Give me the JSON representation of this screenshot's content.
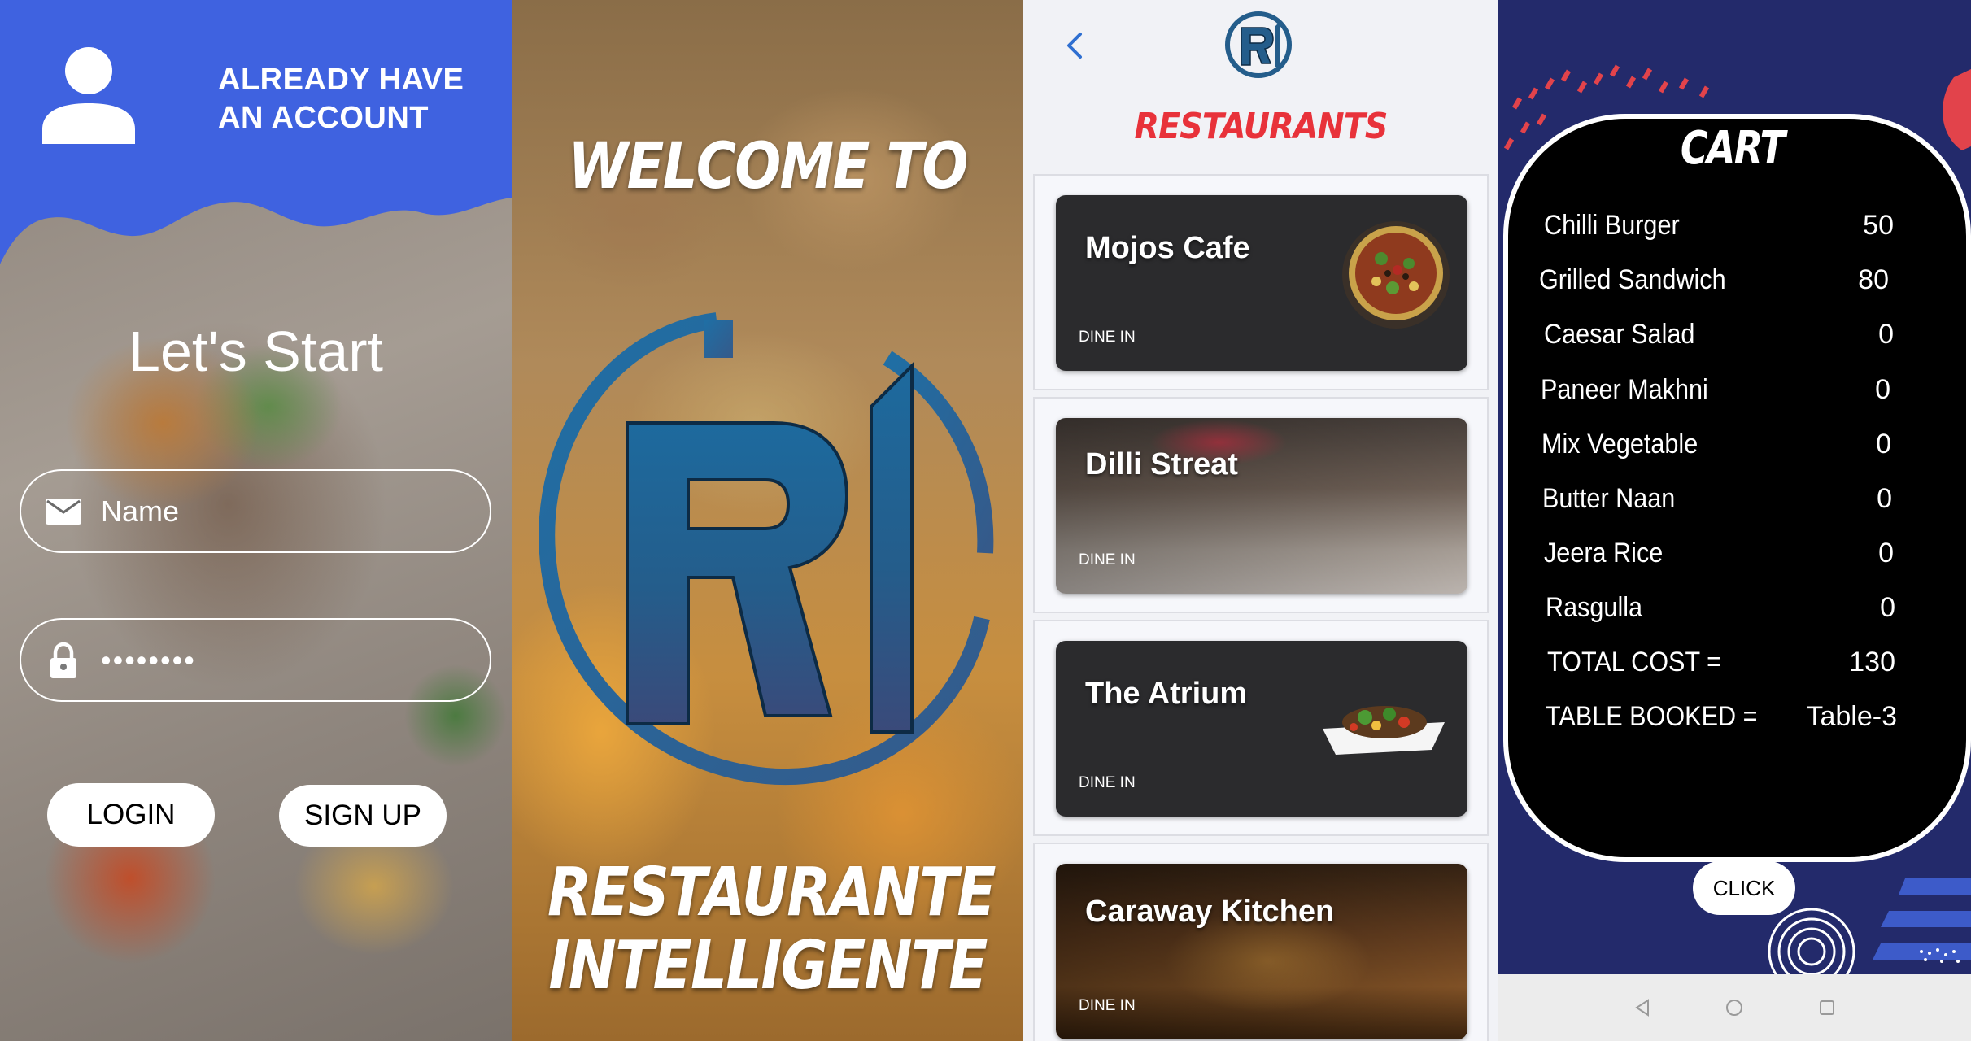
{
  "login": {
    "header": "ALREADY HAVE AN ACCOUNT",
    "title": "Let's Start",
    "name_placeholder": "Name",
    "password_value": "••••••••",
    "login_label": "LOGIN",
    "signup_label": "SIGN UP"
  },
  "welcome": {
    "line1": "WELCOME TO",
    "line2": "RESTAURANTE",
    "line3": "INTELLIGENTE",
    "logo_text": "RI"
  },
  "restaurants": {
    "heading": "RESTAURANTS",
    "items": [
      {
        "name": "Mojos Cafe",
        "tag": "DINE IN"
      },
      {
        "name": "Dilli Streat",
        "tag": "DINE IN"
      },
      {
        "name": "The Atrium",
        "tag": "DINE IN"
      },
      {
        "name": "Caraway Kitchen",
        "tag": "DINE IN"
      }
    ]
  },
  "cart": {
    "title": "CART",
    "items": [
      {
        "name": "Chilli Burger",
        "qty": "50"
      },
      {
        "name": "Grilled Sandwich",
        "qty": "80"
      },
      {
        "name": "Caesar Salad",
        "qty": "0"
      },
      {
        "name": "Paneer Makhni",
        "qty": "0"
      },
      {
        "name": "Mix Vegetable",
        "qty": "0"
      },
      {
        "name": "Butter Naan",
        "qty": "0"
      },
      {
        "name": "Jeera Rice",
        "qty": "0"
      },
      {
        "name": "Rasgulla",
        "qty": "0"
      }
    ],
    "total_label": "TOTAL COST =",
    "total_value": "130",
    "table_label": "TABLE BOOKED =",
    "table_value": "Table-3",
    "click_label": "CLICK"
  },
  "colors": {
    "login_blue": "#3f62e0",
    "heading_red": "#e8323a",
    "cart_navy": "#232a6b",
    "logo_blue": "#1f5a8c"
  }
}
